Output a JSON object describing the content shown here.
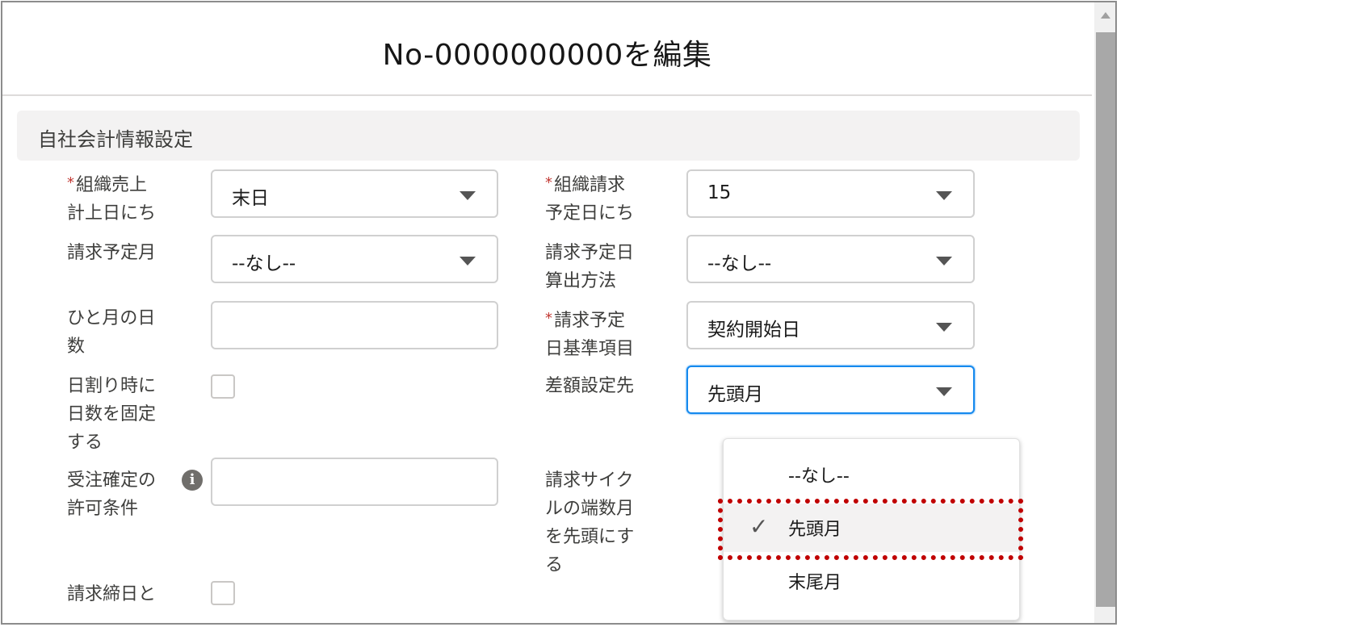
{
  "dialog": {
    "title": "No-0000000000を編集"
  },
  "section": {
    "title": "自社会計情報設定"
  },
  "fields": {
    "sales_day": {
      "required": "*",
      "label": "組織売上\n計上日にち",
      "value": "末日"
    },
    "billing_day": {
      "required": "*",
      "label": "組織請求\n予定日にち",
      "value": "15"
    },
    "billing_month": {
      "label": "請求予定月",
      "value": "--なし--"
    },
    "billing_method": {
      "label": "請求予定日\n算出方法",
      "value": "--なし--"
    },
    "days_per_month": {
      "label": "ひと月の日\n数",
      "value": ""
    },
    "billing_base": {
      "required": "*",
      "label": "請求予定\n日基準項目",
      "value": "契約開始日"
    },
    "fix_days": {
      "label": "日割り時に\n日数を固定\nする"
    },
    "diff_target": {
      "label": "差額設定先",
      "value": "先頭月"
    },
    "order_condition": {
      "label": "受注確定の\n許可条件",
      "value": ""
    },
    "cycle_fraction": {
      "label": "請求サイク\nルの端数月\nを先頭にす\nる"
    },
    "billing_close": {
      "label": "請求締日と"
    }
  },
  "dropdown": {
    "options": [
      "--なし--",
      "先頭月",
      "末尾月"
    ],
    "selected": "先頭月",
    "check_icon": "✓"
  },
  "colors": {
    "required": "#c23934",
    "focus": "#1589ee",
    "highlight_box": "#c00000"
  }
}
